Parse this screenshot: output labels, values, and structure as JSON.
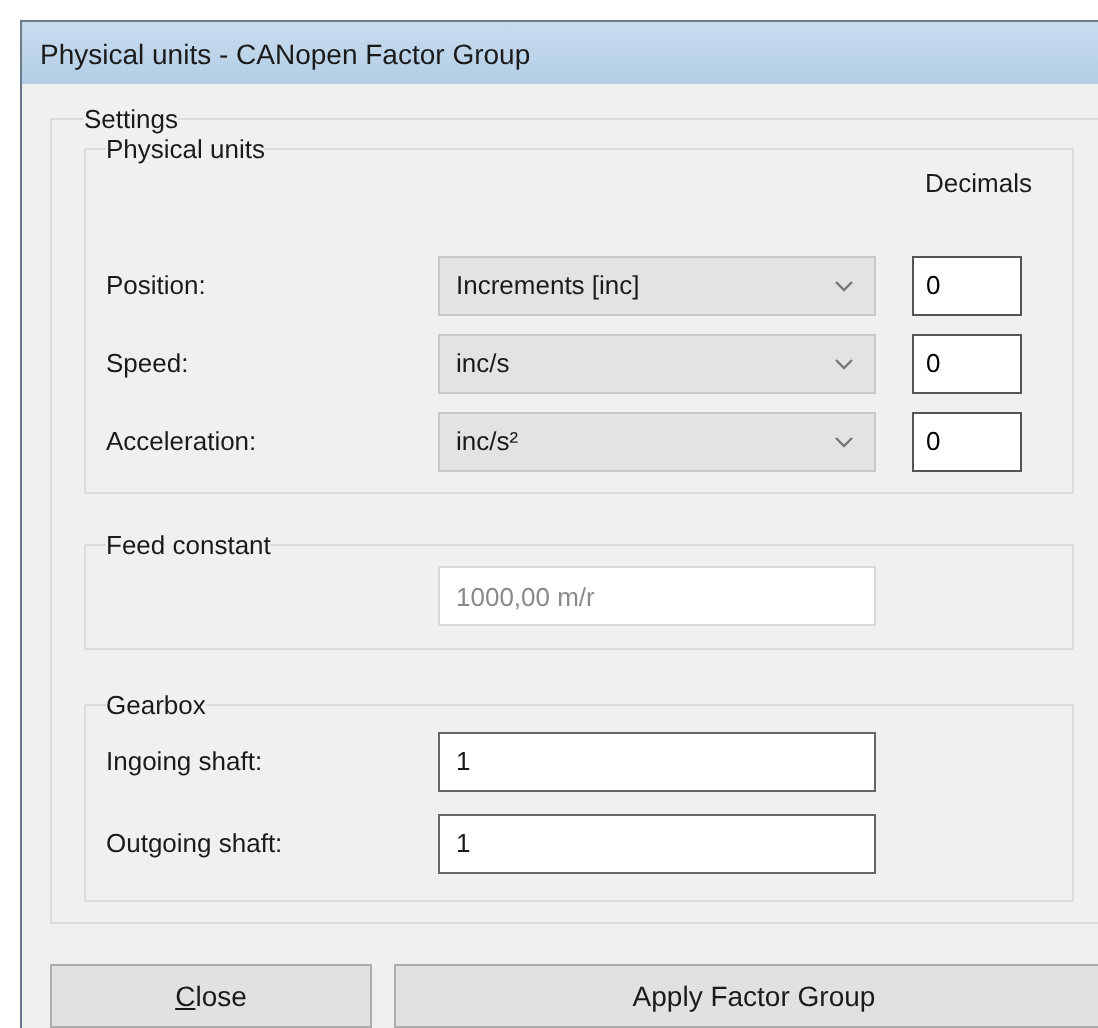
{
  "window": {
    "title": "Physical units - CANopen Factor Group"
  },
  "settings": {
    "title": "Settings",
    "physical_units": {
      "title": "Physical units",
      "decimals_header": "Decimals",
      "rows": [
        {
          "label": "Position:",
          "unit": "Increments [inc]",
          "decimals": "0"
        },
        {
          "label": "Speed:",
          "unit": "inc/s",
          "decimals": "0"
        },
        {
          "label": "Acceleration:",
          "unit": "inc/s²",
          "decimals": "0"
        }
      ]
    },
    "feed_constant": {
      "title": "Feed constant",
      "value": "1000,00 m/r",
      "disabled": true
    },
    "gearbox": {
      "title": "Gearbox",
      "rows": [
        {
          "label": "Ingoing shaft:",
          "value": "1"
        },
        {
          "label": "Outgoing shaft:",
          "value": "1"
        }
      ]
    }
  },
  "buttons": [
    {
      "label": "Close",
      "underline_first": true
    },
    {
      "label": "Apply Factor Group",
      "underline_first": false
    }
  ]
}
